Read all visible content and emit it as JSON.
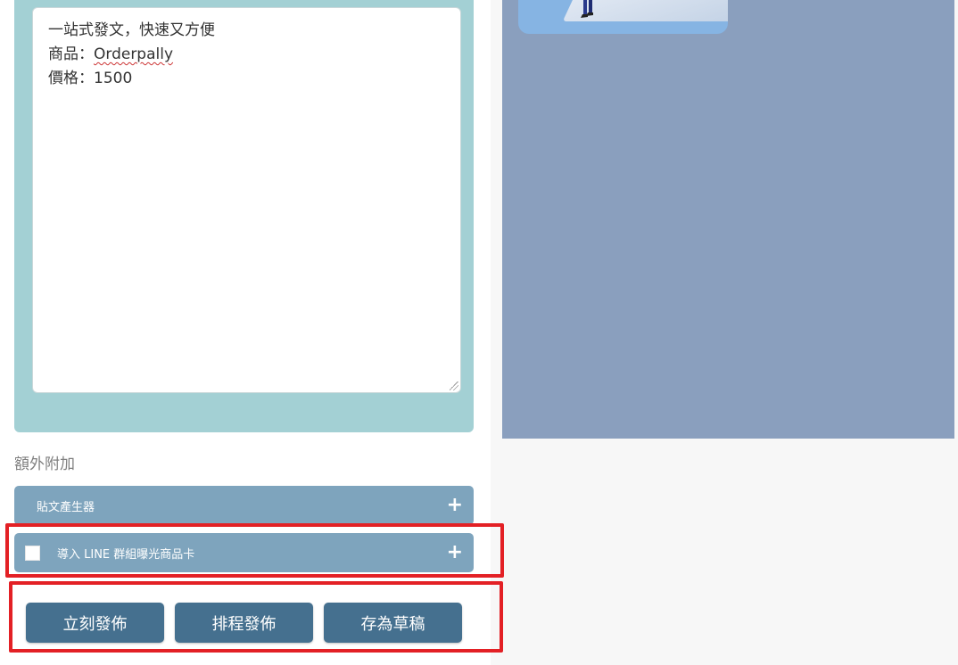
{
  "editor": {
    "lines": [
      {
        "text": "一站式發文，快速又方便"
      },
      {
        "prefix": "商品：",
        "highlighted": "Orderpally"
      },
      {
        "text": "價格：1500"
      }
    ]
  },
  "extras": {
    "title": "額外附加",
    "post_generator_label": "貼文產生器",
    "line_card_label": "導入 LINE 群組曝光商品卡",
    "expand_icon": "+",
    "line_card_checked": false
  },
  "actions": {
    "publish_now": "立刻發佈",
    "schedule_publish": "排程發佈",
    "save_draft": "存為草稿"
  },
  "colors": {
    "editor_bg": "#a3d0d4",
    "accordion_bg": "#7ea4bd",
    "button_bg": "#45708f",
    "preview_bg": "#8a9fbe",
    "highlight_border": "#e32025"
  }
}
